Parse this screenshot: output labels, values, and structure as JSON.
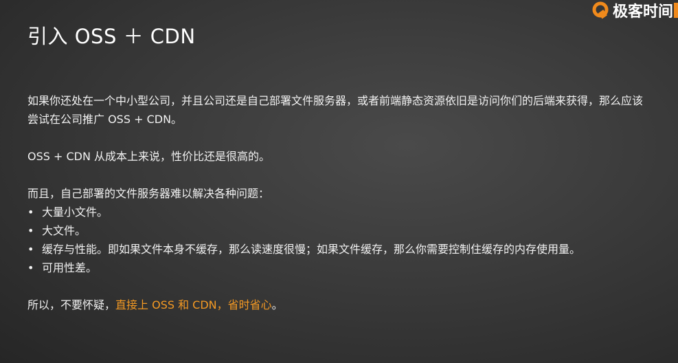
{
  "brand": {
    "name": "极客时间",
    "accent": "#f08a1c"
  },
  "slide": {
    "title": "引入 OSS ＋ CDN",
    "intro": "如果你还处在一个中小型公司，并且公司还是自己部署文件服务器，或者前端静态资源依旧是访问你们的后端来获得，那么应该尝试在公司推广 OSS + CDN。",
    "value_statement": "OSS + CDN 从成本上来说，性价比还是很高的。",
    "problems_intro": "而且，自己部署的文件服务器难以解决各种问题：",
    "bullet_marker": "•",
    "problems": [
      "大量小文件。",
      "大文件。",
      "缓存与性能。即如果文件本身不缓存，那么读速度很慢；如果文件缓存，那么你需要控制住缓存的内存使用量。",
      "可用性差。"
    ],
    "conclusion_prefix": "所以，不要怀疑，",
    "conclusion_highlight": "直接上 OSS 和 CDN，省时省心",
    "conclusion_suffix": "。",
    "highlight_color": "#f59a23"
  }
}
